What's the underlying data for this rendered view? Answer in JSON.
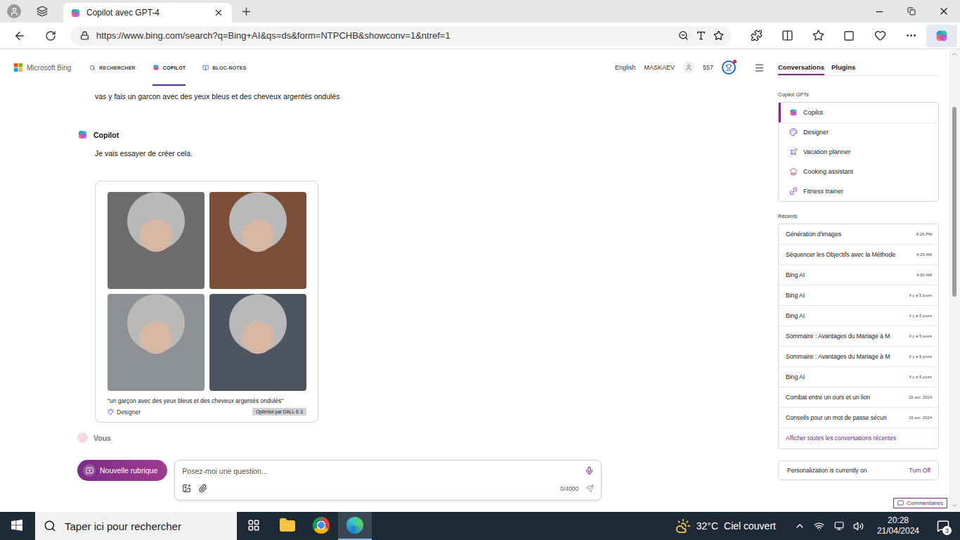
{
  "browser": {
    "tab": {
      "title": "Copilot avec GPT-4",
      "selected": true
    },
    "url": "https://www.bing.com/search?q=Bing+AI&qs=ds&form=NTPCHB&showconv=1&ntref=1"
  },
  "header": {
    "logo": "Microsoft Bing",
    "nav": [
      {
        "label": "RECHERCHER",
        "selected": false
      },
      {
        "label": "COPILOT",
        "selected": true
      },
      {
        "label": "BLOC-NOTES",
        "selected": false
      }
    ],
    "language": "English",
    "user": "MASKAEV",
    "points": "557",
    "rewards_notification": true
  },
  "sidebar_tabs": [
    {
      "label": "Conversations",
      "selected": true
    },
    {
      "label": "Plugins",
      "selected": false
    }
  ],
  "chat": {
    "user_message": "vas y fais un garcon avec des yeux bleus et des cheveux argentés ondulés",
    "reply": {
      "author": "Copilot",
      "text": "Je vais essayer de créer cela.",
      "images": [
        {
          "color": "#6e6c6b"
        },
        {
          "color": "#7b4f37"
        },
        {
          "color": "#8d9094"
        },
        {
          "color": "#4b5661"
        }
      ],
      "caption": "\"un garçon avec des yeux bleus et des cheveux argentés ondulés\"",
      "source": "Designer",
      "badge": "Optimisé par DALL·E 3"
    },
    "next_author": "Vous"
  },
  "composer": {
    "new_topic": "Nouvelle rubrique",
    "placeholder": "Posez-moi une question...",
    "counter": "0/4000"
  },
  "sidebar": {
    "gpts_title": "Copilot GPTs",
    "gpts": [
      {
        "label": "Copilot",
        "kind": "copilot",
        "selected": true
      },
      {
        "label": "Designer",
        "kind": "designer",
        "selected": false
      },
      {
        "label": "Vacation planner",
        "kind": "vacation",
        "selected": false
      },
      {
        "label": "Cooking assistant",
        "kind": "cooking",
        "selected": false
      },
      {
        "label": "Fitness trainer",
        "kind": "fitness",
        "selected": false
      }
    ],
    "recents_title": "Récents",
    "recents": [
      {
        "title": "Génération d'images",
        "time": "8:26 PM"
      },
      {
        "title": "Séquencer les Objectifs avec la Méthode",
        "time": "4:29 AM"
      },
      {
        "title": "Bing AI",
        "time": "4:00 AM"
      },
      {
        "title": "Bing AI",
        "time": "Il y a 5 jours"
      },
      {
        "title": "Bing AI",
        "time": "Il y a 5 jours"
      },
      {
        "title": "Sommaire : Avantages du Mariage à M",
        "time": "Il y a 5 jours"
      },
      {
        "title": "Sommaire : Avantages du Mariage à M",
        "time": "Il y a 5 jours"
      },
      {
        "title": "Bing AI",
        "time": "Il y a 5 jours"
      },
      {
        "title": "Combat entre un ours et un lion",
        "time": "15 avr. 2024"
      },
      {
        "title": "Conseils pour un mot de passe sécuri",
        "time": "15 avr. 2024"
      }
    ],
    "see_all": "Afficher toutes les conversations récentes",
    "personalization": {
      "text": "Personalization is currently on",
      "action": "Turn Off"
    },
    "feedback": "Commentaires"
  },
  "scrollbar": {
    "level": 0.19
  },
  "taskbar": {
    "search_placeholder": "Taper ici pour rechercher",
    "apps": [
      {
        "kind": "explorer",
        "active": false
      },
      {
        "kind": "chrome",
        "active": false
      },
      {
        "kind": "edge",
        "active": true
      }
    ],
    "weather": {
      "temperature": "32°C",
      "condition": "Ciel couvert"
    },
    "time": "20:28",
    "date": "21/04/2024",
    "notifications": "3"
  }
}
